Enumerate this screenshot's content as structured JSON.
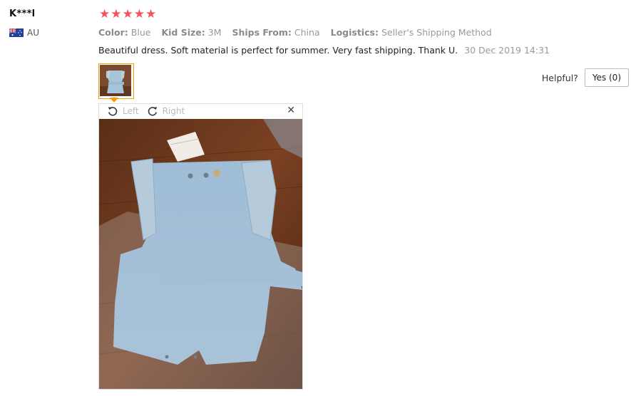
{
  "reviewer": {
    "name": "K***l",
    "country": "AU",
    "flag_icon": "australia-flag-icon"
  },
  "rating": {
    "stars": 5,
    "max": 5,
    "color": "#f2545b"
  },
  "attributes": [
    {
      "key": "Color:",
      "value": "Blue"
    },
    {
      "key": "Kid Size:",
      "value": "3M"
    },
    {
      "key": "Ships From:",
      "value": "China"
    },
    {
      "key": "Logistics:",
      "value": "Seller's Shipping Method"
    }
  ],
  "feedback": {
    "text": "Beautiful dress. Soft material is perfect for summer. Very fast shipping. Thank U.",
    "date": "30 Dec 2019 14:31"
  },
  "helpful": {
    "label": "Helpful?",
    "yes_button": "Yes (0)"
  },
  "viewer": {
    "rotate_left_label": "Left",
    "rotate_right_label": "Right",
    "close_glyph": "✕",
    "accent_color": "#ff9900"
  }
}
